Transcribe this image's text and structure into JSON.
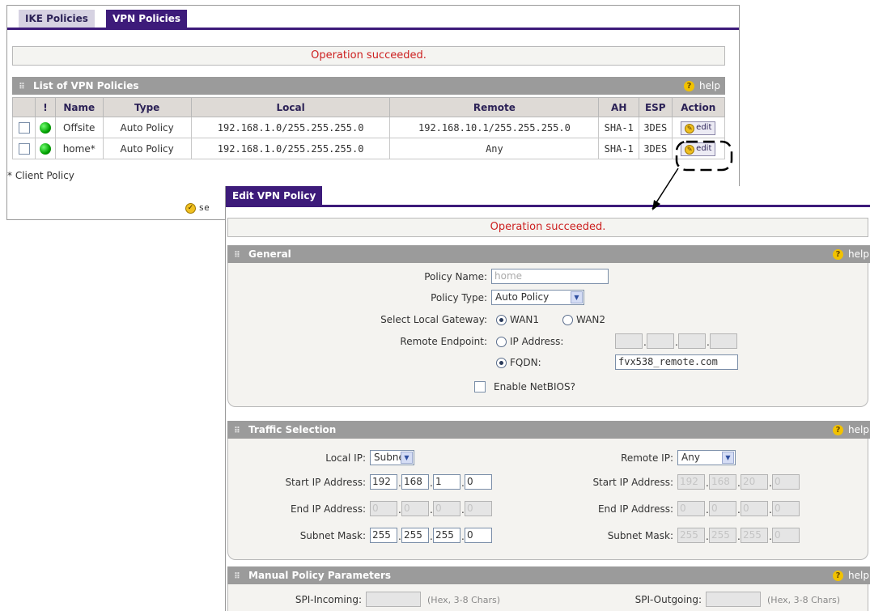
{
  "tabs": {
    "ike": "IKE Policies",
    "vpn": "VPN Policies"
  },
  "list": {
    "message": "Operation succeeded.",
    "section_title": "List of VPN Policies",
    "help": "help",
    "columns": {
      "status": "!",
      "name": "Name",
      "type": "Type",
      "local": "Local",
      "remote": "Remote",
      "ah": "AH",
      "esp": "ESP",
      "action": "Action"
    },
    "rows": [
      {
        "name": "Offsite",
        "type": "Auto Policy",
        "local": "192.168.1.0/255.255.255.0",
        "remote": "192.168.10.1/255.255.255.0",
        "ah": "SHA-1",
        "esp": "3DES",
        "action": "edit"
      },
      {
        "name": "home*",
        "type": "Auto Policy",
        "local": "192.168.1.0/255.255.255.0",
        "remote": "Any",
        "ah": "SHA-1",
        "esp": "3DES",
        "action": "edit"
      }
    ],
    "client_note": "* Client Policy",
    "select_button_partial": "se"
  },
  "edit": {
    "tab": "Edit VPN Policy",
    "message": "Operation succeeded.",
    "help": "help",
    "general": {
      "title": "General",
      "policy_name_label": "Policy Name:",
      "policy_name_value": "home",
      "policy_type_label": "Policy Type:",
      "policy_type_value": "Auto Policy",
      "gateway_label": "Select Local Gateway:",
      "gateway_wan1": "WAN1",
      "gateway_wan2": "WAN2",
      "gateway_selected": "WAN1",
      "remote_endpoint_label": "Remote Endpoint:",
      "ip_address_option": "IP Address:",
      "fqdn_option": "FQDN:",
      "endpoint_selected": "FQDN",
      "fqdn_value": "fvx538_remote.com",
      "netbios_label": "Enable NetBIOS?",
      "netbios_checked": false
    },
    "traffic": {
      "title": "Traffic Selection",
      "local_ip_label": "Local IP:",
      "local_ip_value": "Subnet",
      "remote_ip_label": "Remote IP:",
      "remote_ip_value": "Any",
      "start_ip_label": "Start IP Address:",
      "end_ip_label": "End IP Address:",
      "subnet_mask_label": "Subnet Mask:",
      "local_start": [
        "192",
        "168",
        "1",
        "0"
      ],
      "local_end": [
        "0",
        "0",
        "0",
        "0"
      ],
      "local_mask": [
        "255",
        "255",
        "255",
        "0"
      ],
      "remote_start": [
        "192",
        "168",
        "20",
        "0"
      ],
      "remote_end": [
        "0",
        "0",
        "0",
        "0"
      ],
      "remote_mask": [
        "255",
        "255",
        "255",
        "0"
      ]
    },
    "manual": {
      "title": "Manual Policy Parameters",
      "spi_in_label": "SPI-Incoming:",
      "spi_out_label": "SPI-Outgoing:",
      "spi_hint": "(Hex, 3-8 Chars)"
    }
  }
}
